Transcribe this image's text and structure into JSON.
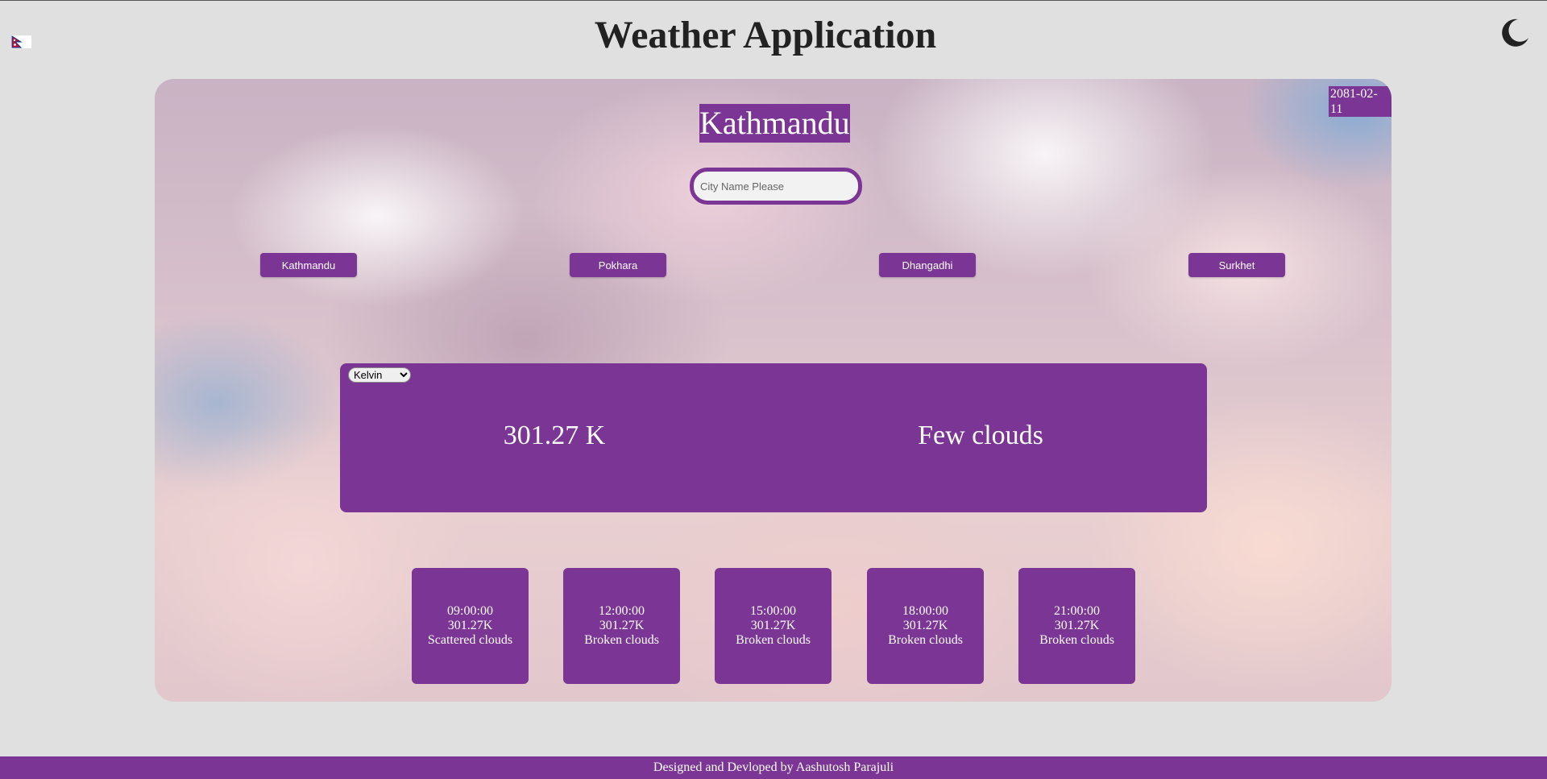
{
  "header": {
    "title": "Weather Application",
    "flag_icon": "nepal-flag-icon",
    "theme_toggle_icon": "moon-icon"
  },
  "card": {
    "date": "2081-02-11",
    "city": "Kathmandu",
    "search": {
      "placeholder": "City Name Please",
      "value": ""
    },
    "city_buttons": [
      "Kathmandu",
      "Pokhara",
      "Dhangadhi",
      "Surkhet"
    ],
    "current": {
      "unit_selected": "Kelvin",
      "temperature": "301.27 K",
      "description": "Few clouds"
    },
    "forecast": [
      {
        "time": "09:00:00",
        "temp": "301.27K",
        "desc": "Scattered clouds"
      },
      {
        "time": "12:00:00",
        "temp": "301.27K",
        "desc": "Broken clouds"
      },
      {
        "time": "15:00:00",
        "temp": "301.27K",
        "desc": "Broken clouds"
      },
      {
        "time": "18:00:00",
        "temp": "301.27K",
        "desc": "Broken clouds"
      },
      {
        "time": "21:00:00",
        "temp": "301.27K",
        "desc": "Broken clouds"
      }
    ]
  },
  "footer": {
    "text": "Designed and Devloped by Aashutosh Parajuli"
  },
  "colors": {
    "accent": "#7b3594",
    "page_background": "#e0e0e0",
    "title_text": "#222222"
  }
}
